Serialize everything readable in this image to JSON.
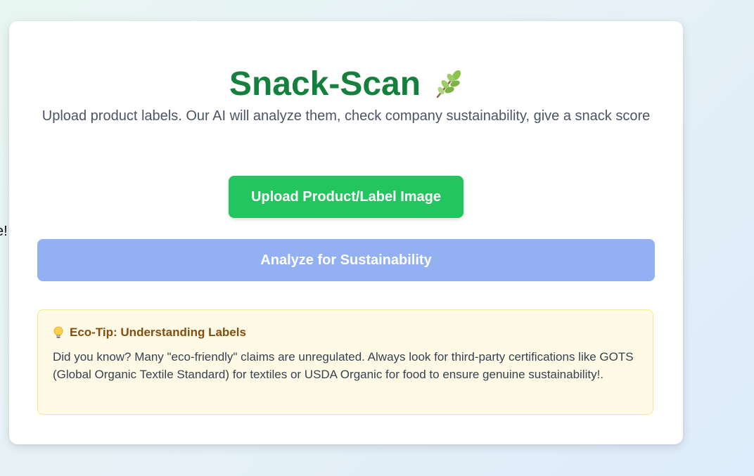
{
  "offscreen_text": "e!",
  "app": {
    "title": "Snack-Scan",
    "title_icon": "leaf-icon",
    "subtitle": "Upload product labels. Our AI will analyze them, check company sustainability, give a snack score"
  },
  "actions": {
    "upload_label": "Upload Product/Label Image",
    "analyze_label": "Analyze for Sustainability"
  },
  "tip": {
    "icon": "lightbulb-icon",
    "heading": "Eco-Tip: Understanding Labels",
    "body": "Did you know? Many \"eco-friendly\" claims are unregulated. Always look for third-party certifications like GOTS (Global Organic Textile Standard) for textiles or USDA Organic for food to ensure genuine sustainability!."
  },
  "colors": {
    "title": "#15803d",
    "upload_button": "#22c55e",
    "analyze_button_disabled": "#93b0f3",
    "tip_background": "#fefae6",
    "tip_heading": "#854d0e"
  }
}
